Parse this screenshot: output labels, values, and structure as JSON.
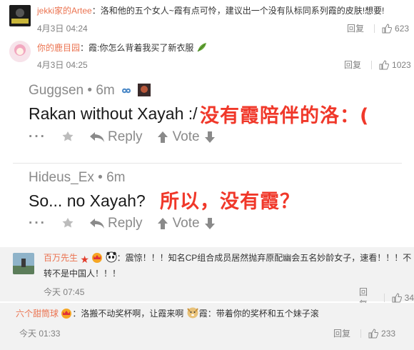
{
  "comments": [
    {
      "username": "jekki家的Artee",
      "text": "：洛和他的五个女人~霞有点可怜，建议出一个没有队标同系列霞的皮肤!想要!",
      "date": "4月3日 04:24",
      "reply": "回复",
      "likes": "623"
    },
    {
      "username": "你的鹿目园",
      "text": "：霞:你怎么背着我买了新衣服",
      "date": "4月3日 04:25",
      "reply": "回复",
      "likes": "1023"
    },
    {
      "username": "百万先生",
      "text_line1": "：震惊！！！知名CP组合成员居然抛弃原配幽会五名妙龄女子，速看！！！不",
      "text_line2": "转不是中国人！！！",
      "date": "今天 07:45",
      "reply": "回复",
      "likes": "34"
    },
    {
      "username": "六个甜筒球",
      "text_a": "：洛搬不动奖杯啊，让霞来啊",
      "text_b": "霞：带着你的奖杯和五个妹子滚",
      "date": "今天 01:33",
      "reply": "回复",
      "likes": "233"
    }
  ],
  "reddit": [
    {
      "author": "Guggsen",
      "time": "6m",
      "body": "Rakan without Xayah :/",
      "translation": "没有霞陪伴的洛：(",
      "reply": "Reply",
      "vote": "Vote"
    },
    {
      "author": "Hideus_Ex",
      "time": "6m",
      "body": "So... no Xayah?",
      "translation": "所以，没有霞？",
      "reply": "Reply",
      "vote": "Vote"
    }
  ],
  "colors": {
    "username": "#eb7350",
    "translation": "#f0382a",
    "meta": "#808080"
  }
}
